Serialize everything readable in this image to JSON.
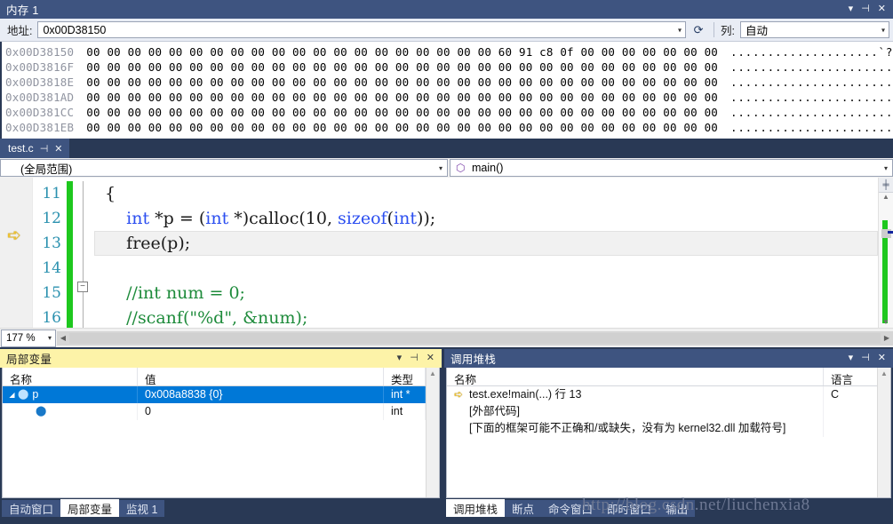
{
  "memory_window": {
    "title": "内存 1",
    "window_buttons": [
      "▾",
      "⊣",
      "✕"
    ],
    "address_label": "地址:",
    "address_value": "0x00D38150",
    "refresh_icon": "⟳",
    "columns_label": "列:",
    "columns_value": "自动",
    "rows": [
      {
        "address": "0x00D38150",
        "hex": "00 00 00 00 00 00 00 00 00 00 00 00 00 00 00 00 00 00 00 00 60 91 c8 0f 00 00 00 00 00 00 00",
        "ascii": "....................`??........"
      },
      {
        "address": "0x00D3816F",
        "hex": "00 00 00 00 00 00 00 00 00 00 00 00 00 00 00 00 00 00 00 00 00 00 00 00 00 00 00 00 00 00 00",
        "ascii": "..............................."
      },
      {
        "address": "0x00D3818E",
        "hex": "00 00 00 00 00 00 00 00 00 00 00 00 00 00 00 00 00 00 00 00 00 00 00 00 00 00 00 00 00 00 00",
        "ascii": "..............................."
      },
      {
        "address": "0x00D381AD",
        "hex": "00 00 00 00 00 00 00 00 00 00 00 00 00 00 00 00 00 00 00 00 00 00 00 00 00 00 00 00 00 00 00",
        "ascii": "..............................."
      },
      {
        "address": "0x00D381CC",
        "hex": "00 00 00 00 00 00 00 00 00 00 00 00 00 00 00 00 00 00 00 00 00 00 00 00 00 00 00 00 00 00 00",
        "ascii": "..............................."
      },
      {
        "address": "0x00D381EB",
        "hex": "00 00 00 00 00 00 00 00 00 00 00 00 00 00 00 00 00 00 00 00 00 00 00 00 00 00 00 00 00 00 00",
        "ascii": "..............................."
      }
    ],
    "scroll_up": "▲",
    "scroll_down": "▼"
  },
  "editor": {
    "tab_label": "test.c",
    "tab_pin_icon": "⊣",
    "tab_close_icon": "✕",
    "scope_value": "(全局范围)",
    "member_value": "main()",
    "member_icon": "⬡",
    "dropdown_arrow": "▾",
    "zoom_value": "177 %",
    "exec_arrow_icon": "➪",
    "fold_icon": "−",
    "split_icon": "╪",
    "scroll_up": "▲",
    "scroll_down": "▼",
    "hscroll_left": "◀",
    "hscroll_right": "▶",
    "first_line_number": 11,
    "lines": [
      {
        "num": "11",
        "tokens": [
          {
            "t": "{",
            "c": "txt"
          }
        ],
        "current": false,
        "fold": false
      },
      {
        "num": "12",
        "tokens": [
          {
            "t": "    ",
            "c": "txt"
          },
          {
            "t": "int",
            "c": "kw"
          },
          {
            "t": " *p = (",
            "c": "txt"
          },
          {
            "t": "int",
            "c": "kw"
          },
          {
            "t": " *)calloc(10, ",
            "c": "txt"
          },
          {
            "t": "sizeof",
            "c": "kw"
          },
          {
            "t": "(",
            "c": "txt"
          },
          {
            "t": "int",
            "c": "kw"
          },
          {
            "t": "));",
            "c": "txt"
          }
        ],
        "current": false,
        "fold": false
      },
      {
        "num": "13",
        "tokens": [
          {
            "t": "    free(p);",
            "c": "txt"
          }
        ],
        "current": true,
        "fold": false
      },
      {
        "num": "14",
        "tokens": [
          {
            "t": "",
            "c": "txt"
          }
        ],
        "current": false,
        "fold": false
      },
      {
        "num": "15",
        "tokens": [
          {
            "t": "    //int num = 0;",
            "c": "cmt"
          }
        ],
        "current": false,
        "fold": true
      },
      {
        "num": "16",
        "tokens": [
          {
            "t": "    //scanf(\"%d\", &num);",
            "c": "cmt"
          }
        ],
        "current": false,
        "fold": false
      }
    ]
  },
  "locals": {
    "title": "局部变量",
    "window_buttons": [
      "▾",
      "⊣",
      "✕"
    ],
    "headers": [
      "名称",
      "值",
      "类型"
    ],
    "rows": [
      {
        "expander": "◢",
        "icon": "field-icon",
        "name": "p",
        "value": "0x008a8838 {0}",
        "type": "int *",
        "selected": true,
        "indent": 0
      },
      {
        "expander": "",
        "icon": "field-icon",
        "name": "",
        "value": "0",
        "type": "int",
        "selected": false,
        "indent": 1
      }
    ],
    "scroll_up": "▲",
    "tabs": [
      {
        "label": "自动窗口",
        "active": false
      },
      {
        "label": "局部变量",
        "active": true
      },
      {
        "label": "监视 1",
        "active": false
      }
    ]
  },
  "call_stack": {
    "title": "调用堆栈",
    "window_buttons": [
      "▾",
      "⊣",
      "✕"
    ],
    "headers": [
      "名称",
      "语言"
    ],
    "rows": [
      {
        "arrow": "➪",
        "name": "test.exe!main(...) 行 13",
        "language": "C"
      },
      {
        "arrow": "",
        "name": "[外部代码]",
        "language": ""
      },
      {
        "arrow": "",
        "name": "[下面的框架可能不正确和/或缺失，没有为 kernel32.dll 加载符号]",
        "language": ""
      }
    ],
    "scroll_up": "▲",
    "tabs": [
      {
        "label": "调用堆栈",
        "active": true
      },
      {
        "label": "断点",
        "active": false
      },
      {
        "label": "命令窗口",
        "active": false
      },
      {
        "label": "即时窗口",
        "active": false
      },
      {
        "label": "输出",
        "active": false
      }
    ]
  },
  "watermark": "http://blog.csdn.net/liuchenxia8",
  "colors": {
    "chrome_dark": "#293955",
    "tab_inactive": "#3e5480",
    "active_panel_title": "#fdf3a8",
    "selection_blue": "#0078d7",
    "change_bar_green": "#1ec81e",
    "keyword_blue": "#2b4ef0",
    "comment_green": "#1e8b3b",
    "linenum_teal": "#2b91af",
    "exec_arrow_yellow": "#f0c330"
  }
}
